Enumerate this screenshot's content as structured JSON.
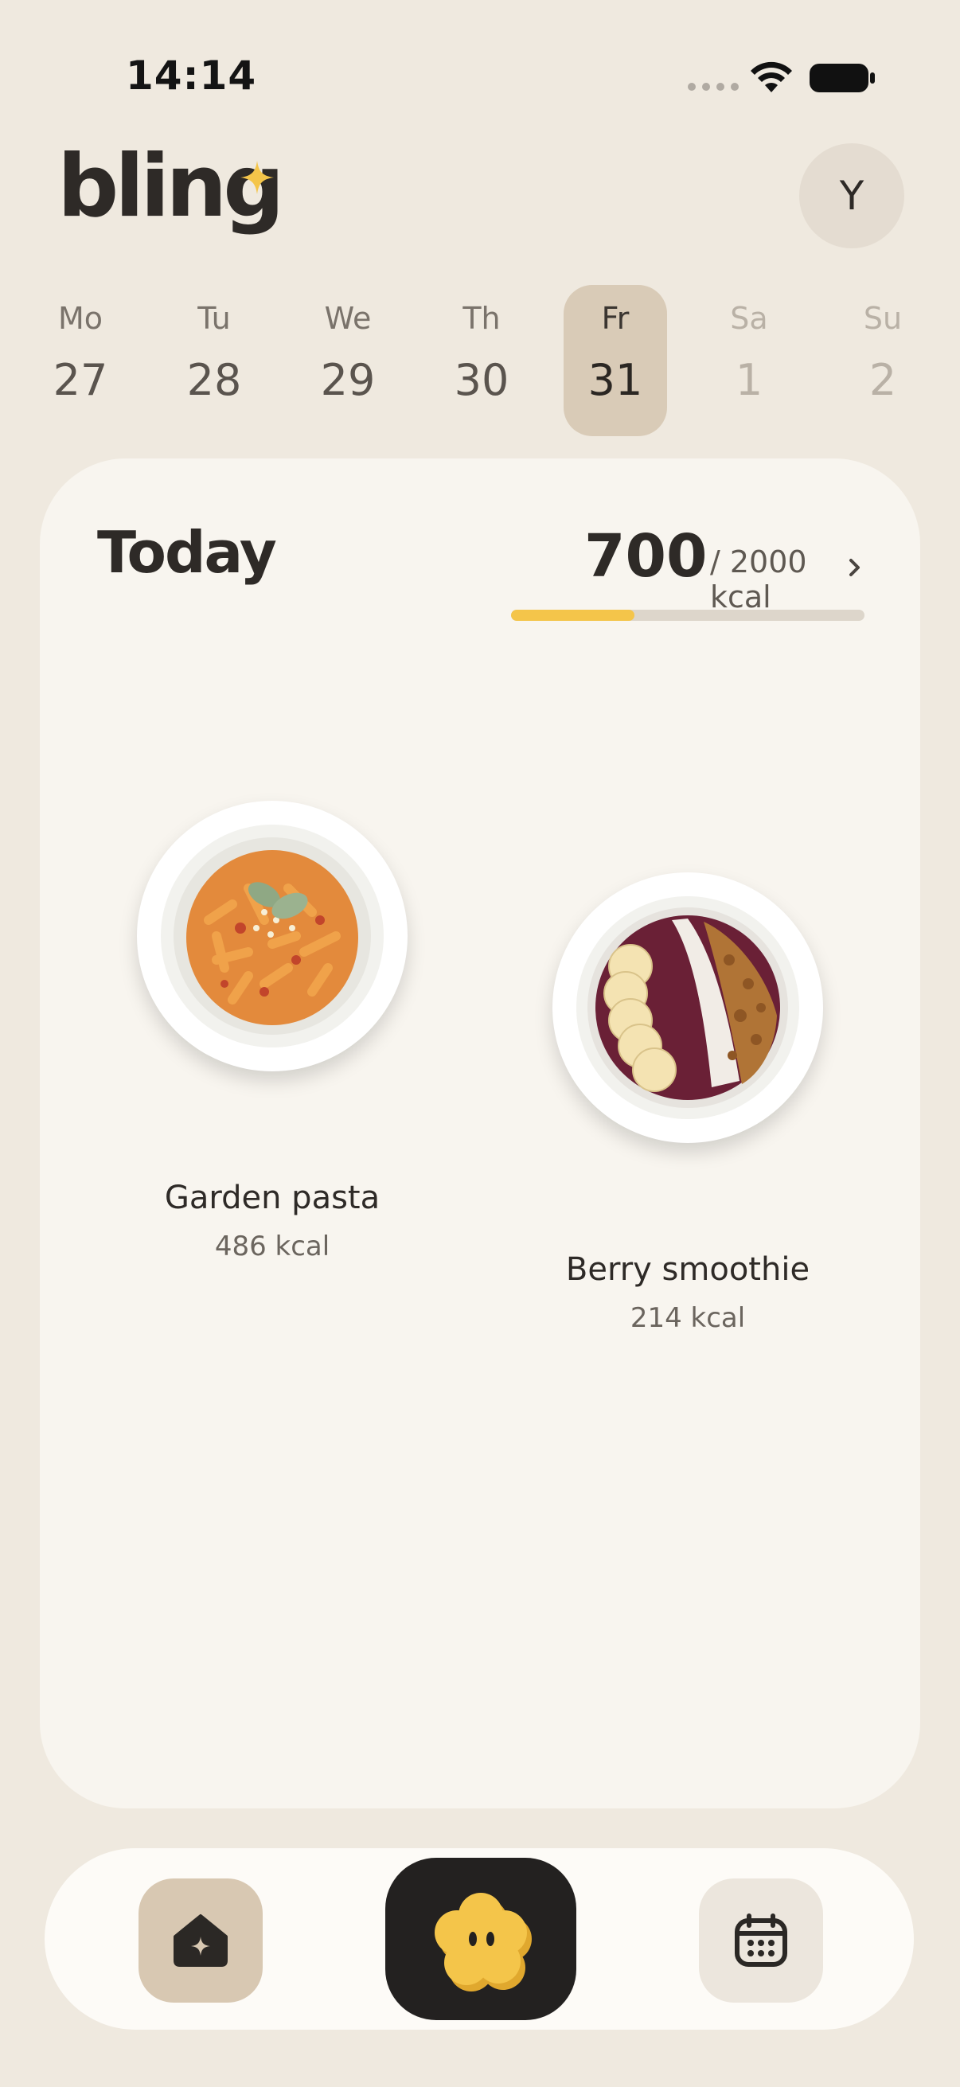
{
  "status_bar": {
    "time": "14:14",
    "icons": [
      "signal-dots",
      "wifi",
      "battery"
    ]
  },
  "header": {
    "logo": "bling",
    "avatar_initial": "Y"
  },
  "week": [
    {
      "name": "Mo",
      "num": "27",
      "state": "past"
    },
    {
      "name": "Tu",
      "num": "28",
      "state": "past"
    },
    {
      "name": "We",
      "num": "29",
      "state": "past"
    },
    {
      "name": "Th",
      "num": "30",
      "state": "past"
    },
    {
      "name": "Fr",
      "num": "31",
      "state": "selected"
    },
    {
      "name": "Sa",
      "num": "1",
      "state": "future"
    },
    {
      "name": "Su",
      "num": "2",
      "state": "future"
    }
  ],
  "today": {
    "title": "Today",
    "kcal_value": "700",
    "kcal_goal": "/ 2000 kcal",
    "progress_fraction": 0.35
  },
  "meals": [
    {
      "name": "Garden pasta",
      "kcal": "486 kcal"
    },
    {
      "name": "Berry smoothie",
      "kcal": "214 kcal"
    }
  ],
  "nav": {
    "items": [
      "home-icon",
      "mascot-icon",
      "calendar-icon"
    ]
  },
  "colors": {
    "background": "#efe9df",
    "card": "#f8f5ef",
    "accent": "#f4c54a",
    "selected_day": "#d9cbb7",
    "nav_center": "#232120"
  }
}
